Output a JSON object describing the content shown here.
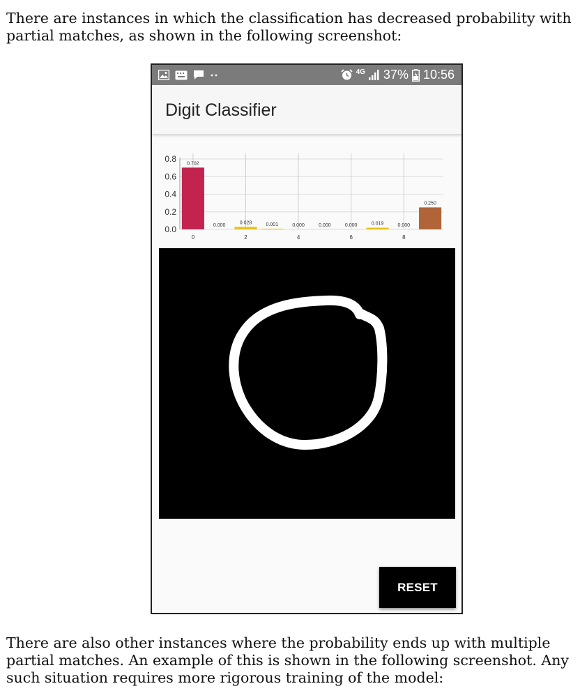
{
  "document": {
    "paragraph_top": "There are instances in which the classification has decreased probability with partial matches, as shown in the following screenshot:",
    "paragraph_bottom": "There are also other instances where the probability ends up with multiple partial matches. An example of this is shown in the following screenshot. Any such situation requires more rigorous training of the model:"
  },
  "status_bar": {
    "icons_left": [
      "image-icon",
      "keyboard-icon",
      "chat-bubble-icon",
      "more-dots-icon"
    ],
    "icons_right": [
      "alarm-icon",
      "network-4g-icon",
      "signal-icon",
      "battery-icon"
    ],
    "network": "4G",
    "battery": "37%",
    "time": "10:56"
  },
  "app_bar": {
    "title": "Digit Classifier"
  },
  "chart_data": {
    "type": "bar",
    "categories": [
      "0",
      "1",
      "2",
      "3",
      "4",
      "5",
      "6",
      "7",
      "8",
      "9"
    ],
    "values": [
      0.702,
      0.0,
      0.028,
      0.001,
      0.0,
      0.0,
      0.0,
      0.019,
      0.0,
      0.25
    ],
    "value_labels": [
      "0.702",
      "0.000",
      "0.028",
      "0.001",
      "0.000",
      "0.000",
      "0.000",
      "0.019",
      "0.000",
      "0.250"
    ],
    "y_ticks": [
      "0.8",
      "0.6",
      "0.4",
      "0.2",
      "0.0"
    ],
    "x_ticks": [
      "0",
      "2",
      "4",
      "6",
      "8"
    ],
    "ylim": [
      0,
      0.8
    ],
    "grid": true,
    "colors": {
      "0": "#c2244f",
      "2": "#e8c019",
      "7": "#e8c019",
      "9": "#b06438"
    },
    "default_bar_color": "#e8c019"
  },
  "drawing_canvas": {
    "background": "#000000",
    "stroke_color": "#ffffff"
  },
  "reset_button": {
    "label": "RESET"
  }
}
